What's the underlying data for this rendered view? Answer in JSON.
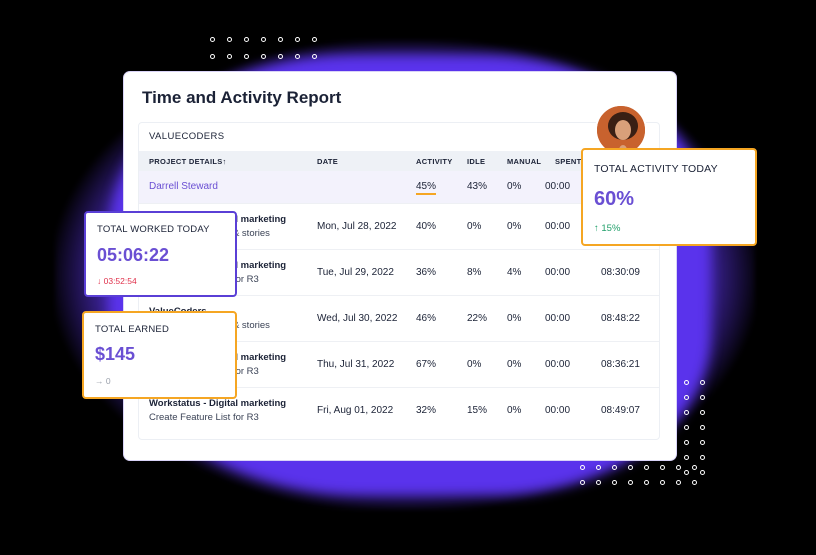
{
  "report": {
    "title": "Time and Activity Report",
    "company": "VALUECODERS",
    "headers": {
      "project": "PROJECT DETAILS",
      "sort_arrow": "↑",
      "date": "DATE",
      "activity": "ACTIVITY",
      "idle": "IDLE",
      "manual": "MANUAL",
      "spent": "SPENT"
    },
    "summary_row": {
      "user": "Darrell Steward",
      "activity": "45%",
      "idle": "43%",
      "manual": "0%",
      "spent": "00:00"
    },
    "rows": [
      {
        "project": "Workstatus - Digital marketing",
        "task": "Create Feature List & stories",
        "date": "Mon, Jul 28, 2022",
        "activity": "40%",
        "idle": "0%",
        "manual": "0%",
        "spent": "00:00",
        "total": ""
      },
      {
        "project": "Workstatus - Digital marketing",
        "task": "Create Feature List for R3",
        "date": "Tue, Jul 29, 2022",
        "activity": "36%",
        "idle": "8%",
        "manual": "4%",
        "spent": "00:00",
        "total": "08:30:09"
      },
      {
        "project": "ValueCoders",
        "task": "Create Feature List & stories",
        "date": "Wed, Jul 30, 2022",
        "activity": "46%",
        "idle": "22%",
        "manual": "0%",
        "spent": "00:00",
        "total": "08:48:22"
      },
      {
        "project": "Workstatus - Digital marketing",
        "task": "Create Feature List for R3",
        "date": "Thu, Jul 31, 2022",
        "activity": "67%",
        "idle": "0%",
        "manual": "0%",
        "spent": "00:00",
        "total": "08:36:21"
      },
      {
        "project": "Workstatus - Digital marketing",
        "task": "Create Feature List for R3",
        "date": "Fri, Aug 01, 2022",
        "activity": "32%",
        "idle": "15%",
        "manual": "0%",
        "spent": "00:00",
        "total": "08:49:07"
      }
    ]
  },
  "cards": {
    "worked": {
      "label": "TOTAL WORKED TODAY",
      "value": "05:06:22",
      "delta": "↓ 03:52:54",
      "delta_color": "#e0314b"
    },
    "earned": {
      "label": "TOTAL EARNED",
      "value": "$145",
      "delta": "→ 0",
      "delta_color": "#9aa0ab"
    },
    "activity": {
      "label": "TOTAL ACTIVITY TODAY",
      "value": "60%",
      "delta": "↑ 15%",
      "delta_color": "#22a06b"
    }
  },
  "colors": {
    "accent": "#6a4fd3",
    "highlight_border": "#f5a623",
    "purple_card_border": "#5a3fd6",
    "background_glow": "#5a33ec"
  },
  "icons": {
    "avatar": "user-avatar"
  }
}
